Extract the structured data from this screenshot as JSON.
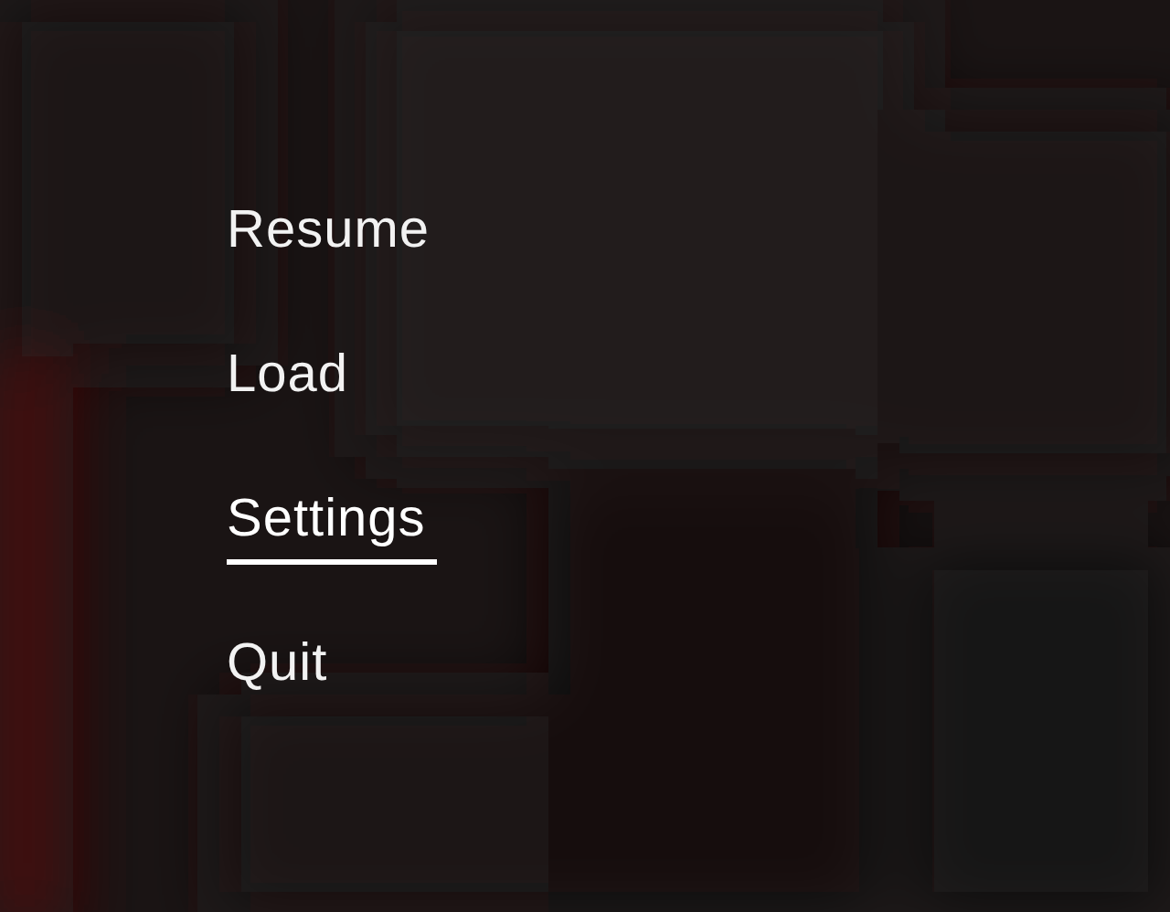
{
  "menu": [
    {
      "label": "Resume",
      "selected": false
    },
    {
      "label": "Load",
      "selected": false
    },
    {
      "label": "Settings",
      "selected": true
    },
    {
      "label": "Quit",
      "selected": false
    }
  ]
}
